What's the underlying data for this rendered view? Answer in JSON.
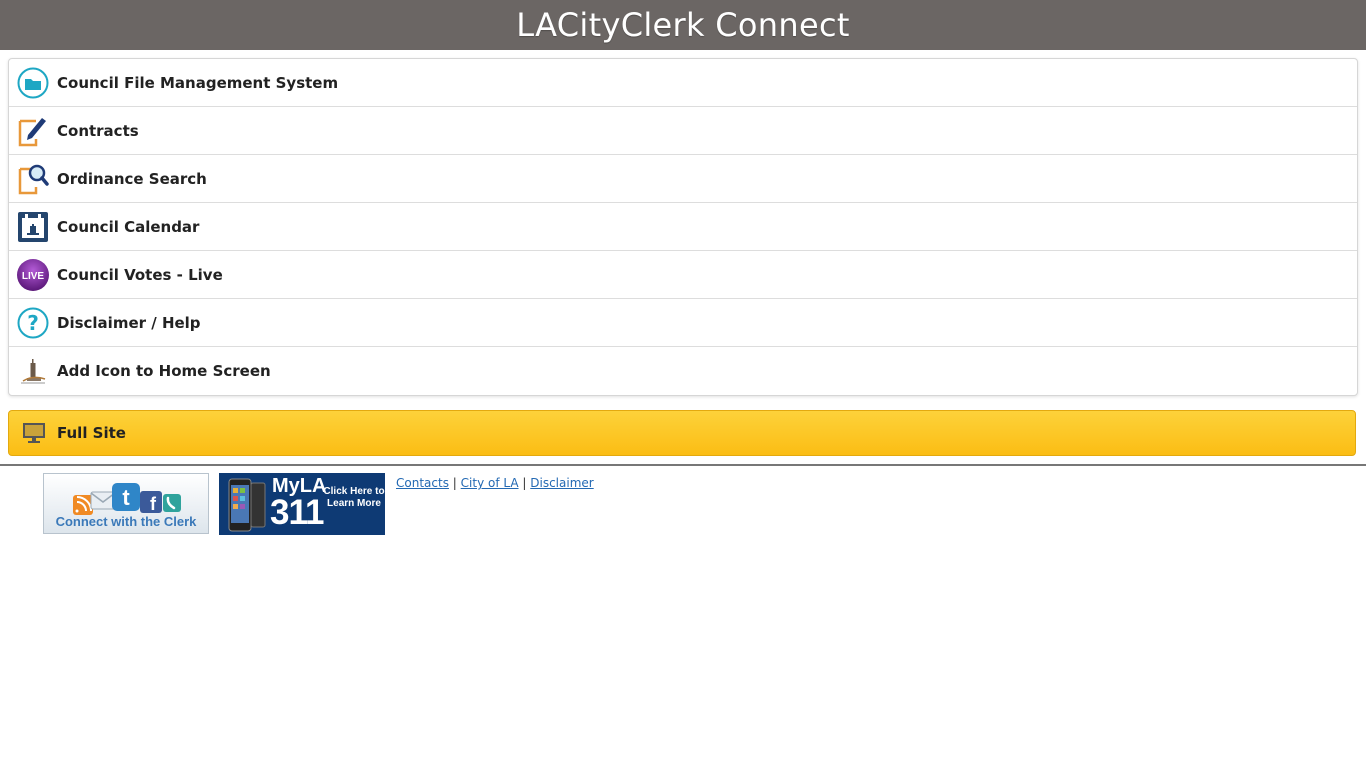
{
  "header": {
    "title": "LACityClerk Connect"
  },
  "menu": {
    "items": [
      {
        "label": "Council File Management System",
        "icon": "folder-icon"
      },
      {
        "label": "Contracts",
        "icon": "pen-document-icon"
      },
      {
        "label": "Ordinance Search",
        "icon": "magnifier-document-icon"
      },
      {
        "label": "Council Calendar",
        "icon": "calendar-icon"
      },
      {
        "label": "Council Votes - Live",
        "icon": "live-icon",
        "badge": "LIVE"
      },
      {
        "label": "Disclaimer / Help",
        "icon": "help-icon",
        "glyph": "?"
      },
      {
        "label": "Add Icon to Home Screen",
        "icon": "city-hall-icon"
      }
    ]
  },
  "full_site": {
    "label": "Full Site",
    "icon": "monitor-icon"
  },
  "footer": {
    "connect_banner": {
      "text": "Connect with the Clerk"
    },
    "myla311_banner": {
      "brand": "MyLA",
      "number": "311",
      "cta": "Click Here to Learn More"
    },
    "links": [
      {
        "label": "Contacts"
      },
      {
        "label": "City of LA"
      },
      {
        "label": "Disclaimer"
      }
    ],
    "separator": "|"
  },
  "colors": {
    "header_bg": "#6b6664",
    "full_site_bg": "#fbc21c",
    "link": "#2369b3",
    "teal": "#1ea7c4",
    "orange": "#e8983a",
    "navy": "#1f4e79"
  }
}
